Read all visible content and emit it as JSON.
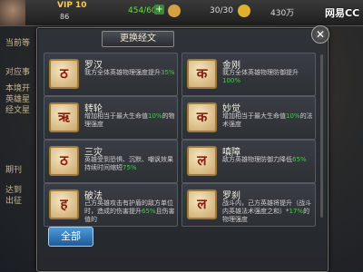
{
  "header": {
    "vip": "VIP 10",
    "level": "86",
    "stamina": "454/60",
    "energy": "30/30",
    "gold": "430万",
    "watermark": "网易CC"
  },
  "background_labels": [
    "当前等",
    "对应事",
    "本境开",
    "英雄星",
    "经文星",
    "期刊",
    "达到",
    "出征"
  ],
  "modal": {
    "title": "更换经文",
    "close": "✕",
    "all_button": "全部"
  },
  "scriptures": [
    {
      "name": "罗汉",
      "glyph": "ठ",
      "desc_pre": "我方全体英雄物理强度提升",
      "highlight": "35%",
      "desc_post": ""
    },
    {
      "name": "金刚",
      "glyph": "क",
      "desc_pre": "我方全体英雄物理防御提升",
      "highlight": "100%",
      "desc_post": ""
    },
    {
      "name": "转轮",
      "glyph": "ऋ",
      "desc_pre": "增加相当于最大生命值",
      "highlight": "10%",
      "desc_post": "的物理强度"
    },
    {
      "name": "妙觉",
      "glyph": "क",
      "desc_pre": "增加相当于最大生命值",
      "highlight": "10%",
      "desc_post": "的法术强度"
    },
    {
      "name": "三灾",
      "glyph": "ठ",
      "desc_pre": "英雄受到恐惧、沉默、嘲讽效果持续时间缩短",
      "highlight": "75%",
      "desc_post": ""
    },
    {
      "name": "嗔障",
      "glyph": "ल",
      "desc_pre": "敌方英雄物理防御力降低",
      "highlight": "65%",
      "desc_post": ""
    },
    {
      "name": "破法",
      "glyph": "ह",
      "desc_pre": "己方英雄攻击有护盾的敌方单位时，造成的伤害提升",
      "highlight": "65%",
      "desc_post": "且伤害值的"
    },
    {
      "name": "罗刹",
      "glyph": "ल",
      "desc_pre": "战斗内，己方英雄将提升（战斗内英雄法术强度之和）*",
      "highlight": "17%",
      "desc_post": "的物理强度"
    }
  ]
}
